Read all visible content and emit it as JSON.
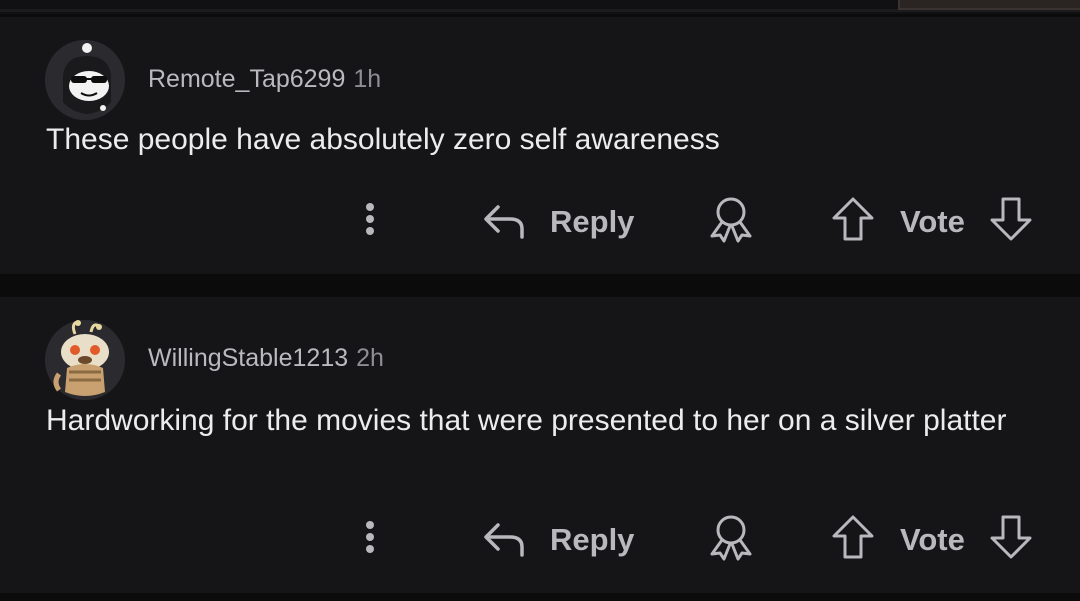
{
  "comments": [
    {
      "username": "Remote_Tap6299",
      "time": "1h",
      "text": "These people have absolutely zero self awareness",
      "avatar_icon": "snoo-sunglasses-avatar-icon",
      "actions": {
        "reply_label": "Reply",
        "vote_label": "Vote"
      }
    },
    {
      "username": "WillingStable1213",
      "time": "2h",
      "text": "Hardworking for the movies that were presented to her on a silver platter",
      "avatar_icon": "snoo-bee-avatar-icon",
      "actions": {
        "reply_label": "Reply",
        "vote_label": "Vote"
      }
    }
  ],
  "colors": {
    "background": "#0b0b0c",
    "card": "#151517",
    "meta_text": "#b9b9be",
    "body_text": "#ececef",
    "action_text": "#b8b8bd"
  }
}
